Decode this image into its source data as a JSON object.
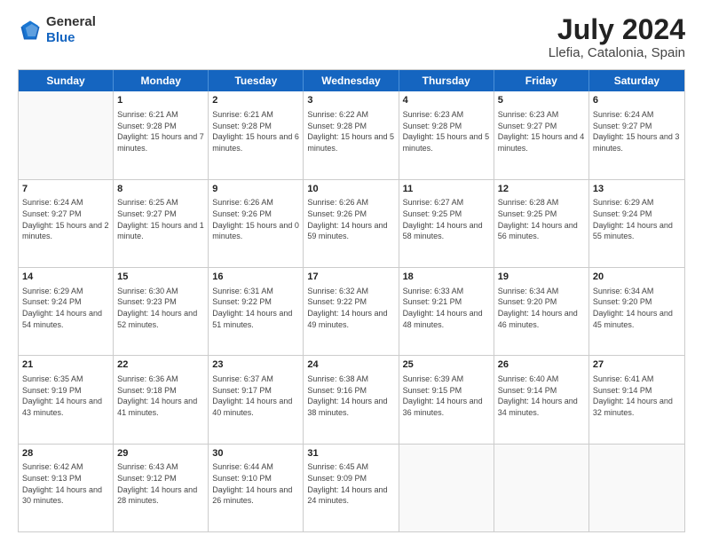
{
  "logo": {
    "general": "General",
    "blue": "Blue"
  },
  "header": {
    "title": "July 2024",
    "subtitle": "Llefia, Catalonia, Spain"
  },
  "days": [
    "Sunday",
    "Monday",
    "Tuesday",
    "Wednesday",
    "Thursday",
    "Friday",
    "Saturday"
  ],
  "weeks": [
    [
      {
        "day": "",
        "sunrise": "",
        "sunset": "",
        "daylight": ""
      },
      {
        "day": "1",
        "sunrise": "Sunrise: 6:21 AM",
        "sunset": "Sunset: 9:28 PM",
        "daylight": "Daylight: 15 hours and 7 minutes."
      },
      {
        "day": "2",
        "sunrise": "Sunrise: 6:21 AM",
        "sunset": "Sunset: 9:28 PM",
        "daylight": "Daylight: 15 hours and 6 minutes."
      },
      {
        "day": "3",
        "sunrise": "Sunrise: 6:22 AM",
        "sunset": "Sunset: 9:28 PM",
        "daylight": "Daylight: 15 hours and 5 minutes."
      },
      {
        "day": "4",
        "sunrise": "Sunrise: 6:23 AM",
        "sunset": "Sunset: 9:28 PM",
        "daylight": "Daylight: 15 hours and 5 minutes."
      },
      {
        "day": "5",
        "sunrise": "Sunrise: 6:23 AM",
        "sunset": "Sunset: 9:27 PM",
        "daylight": "Daylight: 15 hours and 4 minutes."
      },
      {
        "day": "6",
        "sunrise": "Sunrise: 6:24 AM",
        "sunset": "Sunset: 9:27 PM",
        "daylight": "Daylight: 15 hours and 3 minutes."
      }
    ],
    [
      {
        "day": "7",
        "sunrise": "Sunrise: 6:24 AM",
        "sunset": "Sunset: 9:27 PM",
        "daylight": "Daylight: 15 hours and 2 minutes."
      },
      {
        "day": "8",
        "sunrise": "Sunrise: 6:25 AM",
        "sunset": "Sunset: 9:27 PM",
        "daylight": "Daylight: 15 hours and 1 minute."
      },
      {
        "day": "9",
        "sunrise": "Sunrise: 6:26 AM",
        "sunset": "Sunset: 9:26 PM",
        "daylight": "Daylight: 15 hours and 0 minutes."
      },
      {
        "day": "10",
        "sunrise": "Sunrise: 6:26 AM",
        "sunset": "Sunset: 9:26 PM",
        "daylight": "Daylight: 14 hours and 59 minutes."
      },
      {
        "day": "11",
        "sunrise": "Sunrise: 6:27 AM",
        "sunset": "Sunset: 9:25 PM",
        "daylight": "Daylight: 14 hours and 58 minutes."
      },
      {
        "day": "12",
        "sunrise": "Sunrise: 6:28 AM",
        "sunset": "Sunset: 9:25 PM",
        "daylight": "Daylight: 14 hours and 56 minutes."
      },
      {
        "day": "13",
        "sunrise": "Sunrise: 6:29 AM",
        "sunset": "Sunset: 9:24 PM",
        "daylight": "Daylight: 14 hours and 55 minutes."
      }
    ],
    [
      {
        "day": "14",
        "sunrise": "Sunrise: 6:29 AM",
        "sunset": "Sunset: 9:24 PM",
        "daylight": "Daylight: 14 hours and 54 minutes."
      },
      {
        "day": "15",
        "sunrise": "Sunrise: 6:30 AM",
        "sunset": "Sunset: 9:23 PM",
        "daylight": "Daylight: 14 hours and 52 minutes."
      },
      {
        "day": "16",
        "sunrise": "Sunrise: 6:31 AM",
        "sunset": "Sunset: 9:22 PM",
        "daylight": "Daylight: 14 hours and 51 minutes."
      },
      {
        "day": "17",
        "sunrise": "Sunrise: 6:32 AM",
        "sunset": "Sunset: 9:22 PM",
        "daylight": "Daylight: 14 hours and 49 minutes."
      },
      {
        "day": "18",
        "sunrise": "Sunrise: 6:33 AM",
        "sunset": "Sunset: 9:21 PM",
        "daylight": "Daylight: 14 hours and 48 minutes."
      },
      {
        "day": "19",
        "sunrise": "Sunrise: 6:34 AM",
        "sunset": "Sunset: 9:20 PM",
        "daylight": "Daylight: 14 hours and 46 minutes."
      },
      {
        "day": "20",
        "sunrise": "Sunrise: 6:34 AM",
        "sunset": "Sunset: 9:20 PM",
        "daylight": "Daylight: 14 hours and 45 minutes."
      }
    ],
    [
      {
        "day": "21",
        "sunrise": "Sunrise: 6:35 AM",
        "sunset": "Sunset: 9:19 PM",
        "daylight": "Daylight: 14 hours and 43 minutes."
      },
      {
        "day": "22",
        "sunrise": "Sunrise: 6:36 AM",
        "sunset": "Sunset: 9:18 PM",
        "daylight": "Daylight: 14 hours and 41 minutes."
      },
      {
        "day": "23",
        "sunrise": "Sunrise: 6:37 AM",
        "sunset": "Sunset: 9:17 PM",
        "daylight": "Daylight: 14 hours and 40 minutes."
      },
      {
        "day": "24",
        "sunrise": "Sunrise: 6:38 AM",
        "sunset": "Sunset: 9:16 PM",
        "daylight": "Daylight: 14 hours and 38 minutes."
      },
      {
        "day": "25",
        "sunrise": "Sunrise: 6:39 AM",
        "sunset": "Sunset: 9:15 PM",
        "daylight": "Daylight: 14 hours and 36 minutes."
      },
      {
        "day": "26",
        "sunrise": "Sunrise: 6:40 AM",
        "sunset": "Sunset: 9:14 PM",
        "daylight": "Daylight: 14 hours and 34 minutes."
      },
      {
        "day": "27",
        "sunrise": "Sunrise: 6:41 AM",
        "sunset": "Sunset: 9:14 PM",
        "daylight": "Daylight: 14 hours and 32 minutes."
      }
    ],
    [
      {
        "day": "28",
        "sunrise": "Sunrise: 6:42 AM",
        "sunset": "Sunset: 9:13 PM",
        "daylight": "Daylight: 14 hours and 30 minutes."
      },
      {
        "day": "29",
        "sunrise": "Sunrise: 6:43 AM",
        "sunset": "Sunset: 9:12 PM",
        "daylight": "Daylight: 14 hours and 28 minutes."
      },
      {
        "day": "30",
        "sunrise": "Sunrise: 6:44 AM",
        "sunset": "Sunset: 9:10 PM",
        "daylight": "Daylight: 14 hours and 26 minutes."
      },
      {
        "day": "31",
        "sunrise": "Sunrise: 6:45 AM",
        "sunset": "Sunset: 9:09 PM",
        "daylight": "Daylight: 14 hours and 24 minutes."
      },
      {
        "day": "",
        "sunrise": "",
        "sunset": "",
        "daylight": ""
      },
      {
        "day": "",
        "sunrise": "",
        "sunset": "",
        "daylight": ""
      },
      {
        "day": "",
        "sunrise": "",
        "sunset": "",
        "daylight": ""
      }
    ]
  ]
}
